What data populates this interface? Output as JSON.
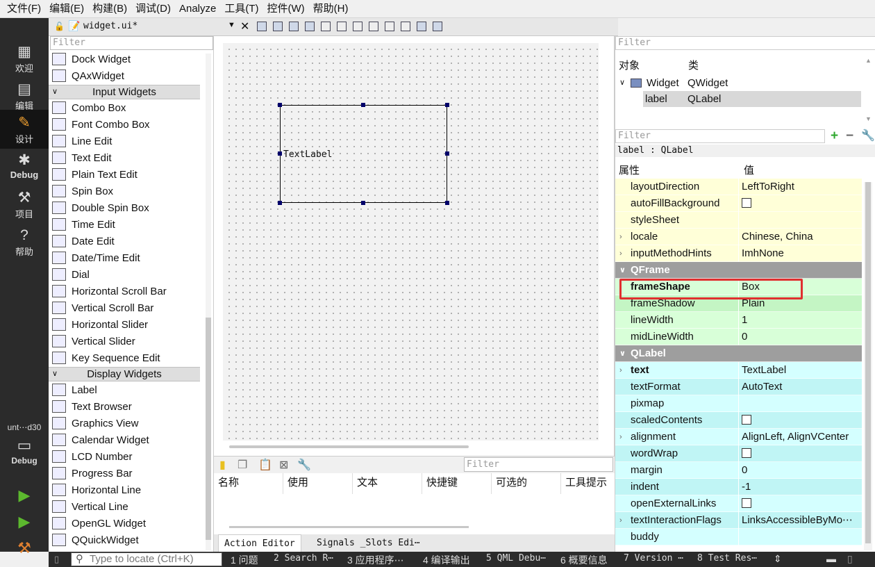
{
  "menu": [
    "文件(F)",
    "编辑(E)",
    "构建(B)",
    "调试(D)",
    "Analyze",
    "工具(T)",
    "控件(W)",
    "帮助(H)"
  ],
  "modes": [
    {
      "label": "欢迎",
      "icon": "grid-icon"
    },
    {
      "label": "编辑",
      "icon": "document-icon"
    },
    {
      "label": "设计",
      "icon": "pencil-icon"
    },
    {
      "label": "Debug",
      "icon": "bug-icon"
    },
    {
      "label": "项目",
      "icon": "wrench-icon"
    },
    {
      "label": "帮助",
      "icon": "help-icon"
    }
  ],
  "kit": {
    "name": "unt⋯d30",
    "mode": "Debug"
  },
  "document": {
    "filename": "widget.ui*"
  },
  "widget_box": {
    "filter_placeholder": "Filter",
    "top_items": [
      "Dock Widget",
      "QAxWidget"
    ],
    "input_category": "Input Widgets",
    "input_items": [
      "Combo Box",
      "Font Combo Box",
      "Line Edit",
      "Text Edit",
      "Plain Text Edit",
      "Spin Box",
      "Double Spin Box",
      "Time Edit",
      "Date Edit",
      "Date/Time Edit",
      "Dial",
      "Horizontal Scroll Bar",
      "Vertical Scroll Bar",
      "Horizontal Slider",
      "Vertical Slider",
      "Key Sequence Edit"
    ],
    "display_category": "Display Widgets",
    "display_items": [
      "Label",
      "Text Browser",
      "Graphics View",
      "Calendar Widget",
      "LCD Number",
      "Progress Bar",
      "Horizontal Line",
      "Vertical Line",
      "OpenGL Widget",
      "QQuickWidget"
    ]
  },
  "form": {
    "label_text": "TextLabel"
  },
  "action_editor": {
    "filter_placeholder": "Filter",
    "columns": [
      "名称",
      "使用",
      "文本",
      "快捷键",
      "可选的",
      "工具提示"
    ],
    "tabs": [
      "Action Editor",
      "Signals _Slots Edi⋯"
    ]
  },
  "object_inspector": {
    "filter_placeholder": "Filter",
    "col_object": "对象",
    "col_class": "类",
    "rows": [
      {
        "name": "Widget",
        "class": "QWidget"
      },
      {
        "name": "label",
        "class": "QLabel"
      }
    ]
  },
  "property_editor": {
    "filter_placeholder": "Filter",
    "object_class": "label : QLabel",
    "col_property": "属性",
    "col_value": "值",
    "rows": [
      {
        "name": "layoutDirection",
        "value": "LeftToRight"
      },
      {
        "name": "autoFillBackground",
        "value": ""
      },
      {
        "name": "styleSheet",
        "value": ""
      },
      {
        "name": "locale",
        "value": "Chinese, China"
      },
      {
        "name": "inputMethodHints",
        "value": "ImhNone"
      },
      {
        "name": "QFrame",
        "value": ""
      },
      {
        "name": "frameShape",
        "value": "Box"
      },
      {
        "name": "frameShadow",
        "value": "Plain"
      },
      {
        "name": "lineWidth",
        "value": "1"
      },
      {
        "name": "midLineWidth",
        "value": "0"
      },
      {
        "name": "QLabel",
        "value": ""
      },
      {
        "name": "text",
        "value": "TextLabel"
      },
      {
        "name": "textFormat",
        "value": "AutoText"
      },
      {
        "name": "pixmap",
        "value": ""
      },
      {
        "name": "scaledContents",
        "value": ""
      },
      {
        "name": "alignment",
        "value": "AlignLeft, AlignVCenter"
      },
      {
        "name": "wordWrap",
        "value": ""
      },
      {
        "name": "margin",
        "value": "0"
      },
      {
        "name": "indent",
        "value": "-1"
      },
      {
        "name": "openExternalLinks",
        "value": ""
      },
      {
        "name": "textInteractionFlags",
        "value": "LinksAccessibleByMo⋯"
      },
      {
        "name": "buddy",
        "value": ""
      }
    ]
  },
  "status": {
    "locate_placeholder": "Type to locate (Ctrl+K)",
    "panes": [
      "1 问题",
      "2 Search R⋯",
      "3 应用程序⋯",
      "4 编译输出",
      "5 QML Debu⋯",
      "6 概要信息",
      "7 Version ⋯",
      "8 Test Res⋯"
    ]
  },
  "colors": {
    "highlight": "#e03030",
    "handle": "#00006a",
    "sidebar": "#2b2b2b"
  }
}
